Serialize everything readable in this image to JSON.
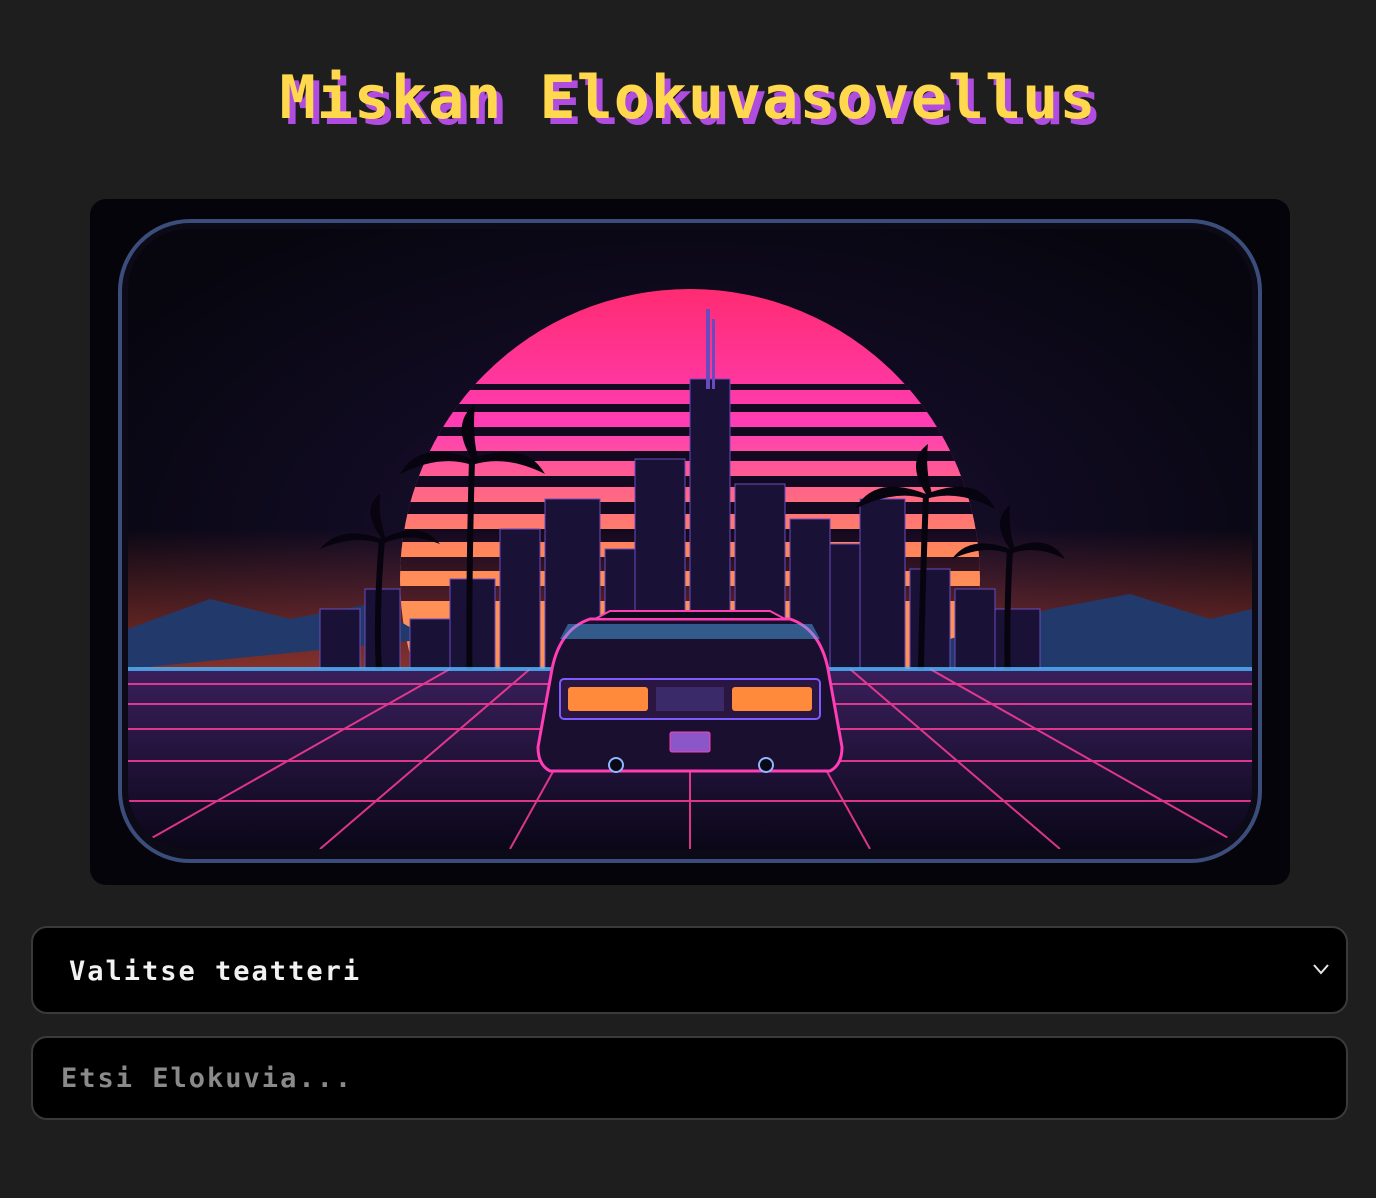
{
  "header": {
    "title": "Miskan Elokuvasovellus"
  },
  "hero": {
    "image": "synthwave-sunset-car-illustration"
  },
  "theater_select": {
    "selected": "Valitse teatteri",
    "icon": "chevron-down-icon"
  },
  "search": {
    "placeholder": "Etsi Elokuvia...",
    "value": ""
  },
  "colors": {
    "background": "#1e1e1e",
    "title": "#ffd84d",
    "title_shadow": "#b04ce0",
    "field_background": "#000000",
    "field_border": "#3a3a3a"
  }
}
